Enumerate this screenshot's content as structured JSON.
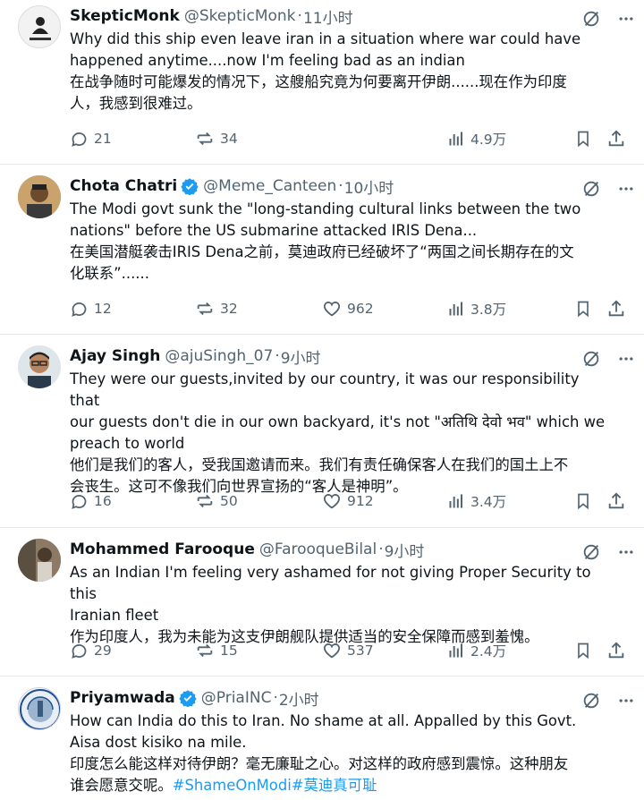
{
  "tweets": [
    {
      "name": "SkepticMonk",
      "verified": false,
      "handle": "@SkepticMonk",
      "time": "11小时",
      "lines": [
        "Why did this ship even leave iran in a situation where war could have",
        "happened anytime....now I'm feeling bad as an indian",
        "在战争随时可能爆发的情况下，这艘船究竟为何要离开伊朗......现在作为印度",
        "人，我感到很难过。"
      ],
      "avatar_text": "SKEPTIC MONK",
      "replies": "21",
      "reposts": "34",
      "likes": "",
      "views": "4.9万"
    },
    {
      "name": "Chota Chatri",
      "verified": true,
      "handle": "@Meme_Canteen",
      "time": "10小时",
      "lines": [
        "The Modi govt sunk the \"long-standing cultural links between the two",
        "nations\" before the US submarine attacked IRIS Dena...",
        "在美国潜艇袭击IRIS Dena之前，莫迪政府已经破坏了“两国之间长期存在的文",
        "化联系”......"
      ],
      "replies": "12",
      "reposts": "32",
      "likes": "962",
      "views": "3.8万"
    },
    {
      "name": "Ajay Singh",
      "verified": false,
      "handle": "@ajuSingh_07",
      "time": "9小时",
      "lines": [
        "They were our guests,invited by our country, it was our responsibility that",
        "our guests don't die in our own backyard, it's not \"अतिथि देवो भव\" which we",
        "preach to world",
        "他们是我们的客人，受我国邀请而来。我们有责任确保客人在我们的国土上不",
        "会丧生。这可不像我们向世界宣扬的“客人是神明”。"
      ],
      "replies": "16",
      "reposts": "50",
      "likes": "912",
      "views": "3.4万"
    },
    {
      "name": "Mohammed Farooque",
      "verified": false,
      "handle": "@FarooqueBilal",
      "time": "9小时",
      "lines": [
        "As an Indian I'm feeling very ashamed for not giving Proper Security to this",
        "Iranian fleet",
        "作为印度人，我为未能为这支伊朗舰队提供适当的安全保障而感到羞愧。"
      ],
      "replies": "29",
      "reposts": "15",
      "likes": "537",
      "views": "2.4万"
    },
    {
      "name": "Priyamwada",
      "verified": true,
      "handle": "@PriaINC",
      "time": "2小时",
      "lines": [
        "How can India do this to Iran. No shame at all. Appalled by this Govt.",
        "Aisa dost kisiko na mile.",
        "印度怎么能这样对待伊朗？毫无廉耻之心。对这样的政府感到震惊。这种朋友"
      ],
      "last_line_text": "谁会愿意交呢。",
      "hashtag": "#ShameOnModi#莫迪真可耻"
    }
  ],
  "colors": {
    "text": "#0f1419",
    "muted": "#536471",
    "verified": "#1d9bf0",
    "hashtag": "#1d9bf0",
    "divider": "#e6e9ec"
  },
  "icons": [
    "grok-icon",
    "more-icon",
    "reply-icon",
    "repost-icon",
    "like-icon",
    "views-icon",
    "bookmark-icon",
    "share-icon",
    "verified-badge-icon"
  ]
}
